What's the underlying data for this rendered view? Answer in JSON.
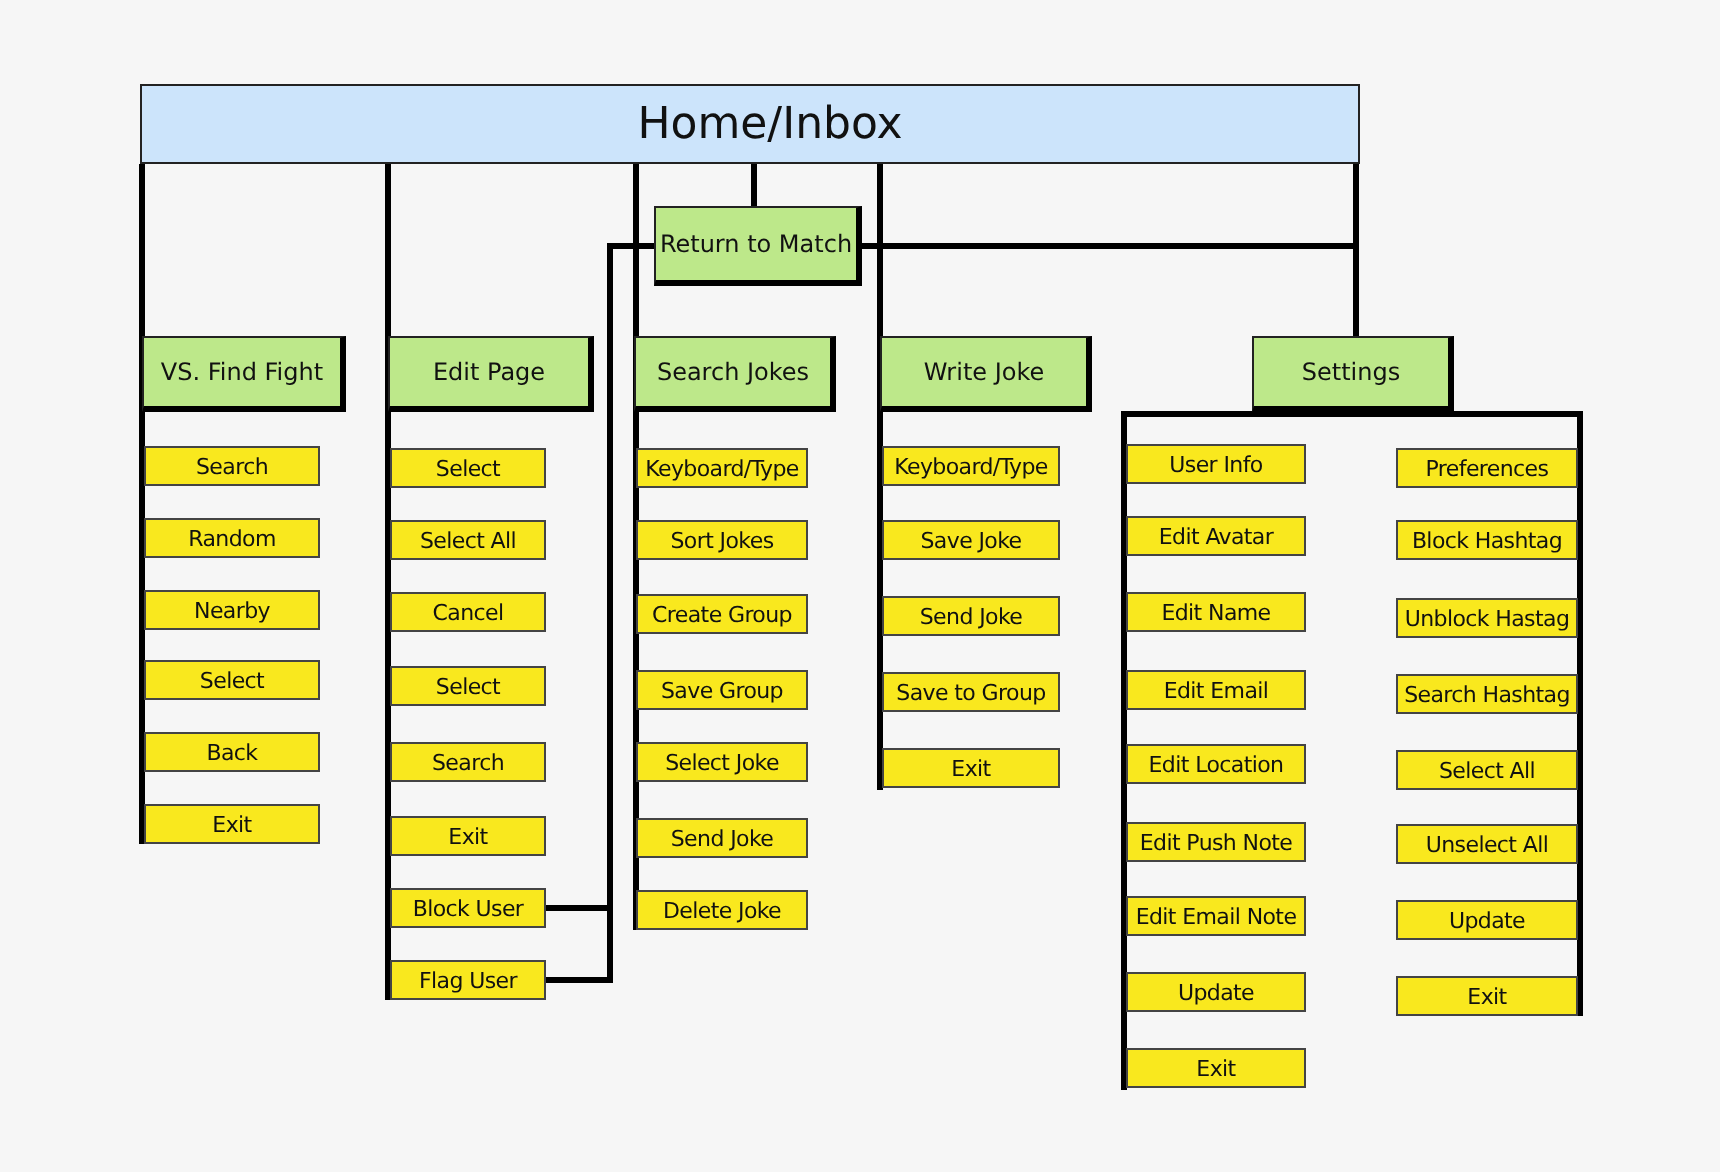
{
  "root": {
    "title": "Home/Inbox"
  },
  "return_node": {
    "label": "Return to Match"
  },
  "columns": [
    {
      "header": "VS. Find Fight",
      "items": [
        "Search",
        "Random",
        "Nearby",
        "Select",
        "Back",
        "Exit"
      ]
    },
    {
      "header": "Edit Page",
      "items": [
        "Select",
        "Select All",
        "Cancel",
        "Select",
        "Search",
        "Exit",
        "Block User",
        "Flag User"
      ]
    },
    {
      "header": "Search Jokes",
      "items": [
        "Keyboard/Type",
        "Sort Jokes",
        "Create Group",
        "Save Group",
        "Select Joke",
        "Send Joke",
        "Delete Joke"
      ]
    },
    {
      "header": "Write Joke",
      "items": [
        "Keyboard/Type",
        "Save Joke",
        "Send Joke",
        "Save to Group",
        "Exit"
      ]
    },
    {
      "header": "Settings",
      "items": [
        "User Info",
        "Edit Avatar",
        "Edit Name",
        "Edit Email",
        "Edit Location",
        "Edit Push Note",
        "Edit Email Note",
        "Update",
        "Exit"
      ],
      "items_right": [
        "Preferences",
        "Block Hashtag",
        "Unblock Hastag",
        "Search Hashtag",
        "Select All",
        "Unselect All",
        "Update",
        "Exit"
      ]
    }
  ]
}
